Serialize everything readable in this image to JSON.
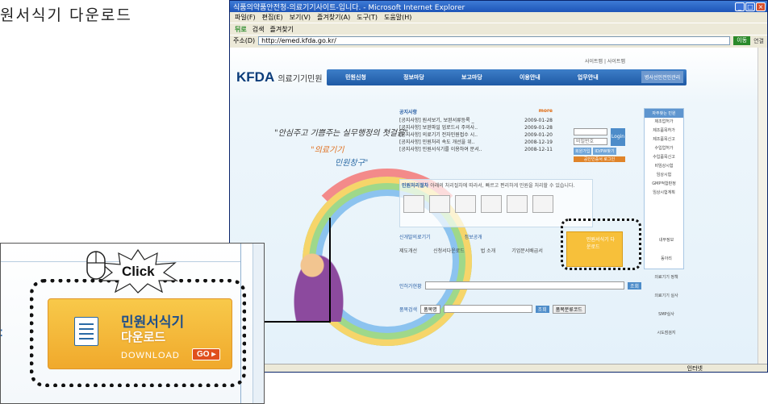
{
  "page_heading": "원서식기 다운로드",
  "window": {
    "title": "식품의약품안전청-의료기기사이트-입니다. - Microsoft Internet Explorer",
    "menu": [
      "파일(F)",
      "편집(E)",
      "보기(V)",
      "즐겨찾기(A)",
      "도구(T)",
      "도움말(H)"
    ],
    "toolbar": [
      "뒤로",
      "검색",
      "즐겨찾기"
    ],
    "address_label": "주소(D)",
    "address": "http://emed.kfda.go.kr/",
    "go_label": "이동",
    "links_label": "연결",
    "status": "인터넷"
  },
  "site": {
    "util_links": "사이트맵  |  사이트맵",
    "logo": "KFDA",
    "logo_sub": "의료기기민원",
    "gnb": [
      "민원신청",
      "정보마당",
      "보고마당",
      "이용안내",
      "업무안내"
    ],
    "gnb_extra": "병사선인전인관리",
    "slogan1": "\"안심주고 기쁨주는 실무행정의 첫걸음\"",
    "slogan2": "\"의료기기",
    "slogan3": "민원창구\"",
    "notice": {
      "title": "공지사항",
      "more": "more",
      "rows": [
        {
          "text": "[공지사항] 원서보기, 보완서류등록 _",
          "date": "2009-01-28"
        },
        {
          "text": "[공지사항] 보완파일 업로드시 주의사..",
          "date": "2009-01-28"
        },
        {
          "text": "[공지사항] 의료기기 전자민원접수 시..",
          "date": "2009-01-20"
        },
        {
          "text": "[공지사항] 민원처리 속도 개선을 위..",
          "date": "2008-12-19"
        },
        {
          "text": "[공지사항] 민원서식기를 이용하여 문서..",
          "date": "2008-12-11"
        }
      ]
    },
    "login": {
      "pw_placeholder": "비밀번호",
      "btn": "Login",
      "join": "회원가입",
      "find": "ID/PW찾기",
      "cert": "공인인증서 로그인"
    },
    "right_menu": {
      "title": "자주찾는 민원",
      "items": [
        "제조업허가",
        "제조품목허가",
        "제조품목신고",
        "수입업허가",
        "수입품목신고",
        "비임상시험",
        "임상시험",
        "GMP적합판정",
        "임상시험계획"
      ]
    },
    "process": {
      "title": "민원처리절차",
      "desc": "아래의 처리절차에 따라서, 빠르고 편리하게 민원을 처리할 수 있습니다."
    },
    "sec2": {
      "title1": "신개발의료기기",
      "title2": "정보공개",
      "items": [
        "제도개선",
        "신청서다운로드",
        "법 소개",
        "기업문서배급서"
      ]
    },
    "mini_banner": "민원서식기 다운로드",
    "search1": {
      "label": "인허가현황",
      "btn": "조회"
    },
    "search2": {
      "label": "품목검색",
      "select": "품목명",
      "btn": "조회",
      "btn2": "품목분류코드"
    },
    "side_icons": [
      "내부정보",
      "동아리",
      "의료기기 정책",
      "의료기기 실사",
      "SMP실사",
      "시도점검지"
    ]
  },
  "zoom": {
    "click_label": "Click",
    "banner_title": "민원서식기",
    "banner_title2": "다운로드",
    "banner_dl": "DOWNLOAD",
    "banner_go": "GO ▸"
  }
}
